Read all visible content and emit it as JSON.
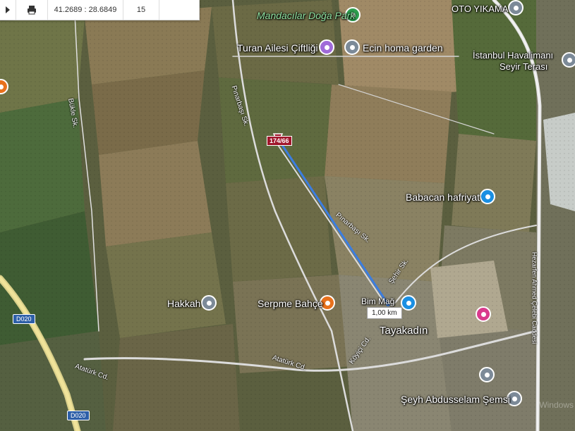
{
  "toolbar": {
    "coords": "41.2689 : 28.6849",
    "zoom": "15"
  },
  "places": {
    "mandacilar": "Mandacılar Doğa Park",
    "oto_yikama": "OTO YIKAMA",
    "turan": "Turan Ailesi Çiftliği",
    "ecin": "Ecin homa garden",
    "istanbul_airport": "İstanbul Havalimanı",
    "seyir": "Seyir Terası",
    "babacan": "Babacan hafriyat",
    "hakkah": "Hakkah",
    "serpme": "Serpme Bahçe",
    "bim": "Bim Mağ",
    "tayakadin": "Tayakadın",
    "seyh": "Şeyh Abdusselam Şemsi"
  },
  "roads": {
    "pinarbasi_upper": "Pınarbaşı Sk.",
    "pinarbasi_lower": "Pınarbaşı Sk.",
    "bukle": "Bükle Sk.",
    "ataturk_left": "Atatürk Cd.",
    "ataturk_right": "Atatürk Cd.",
    "koyici": "Köyiçi Cd.",
    "sehir": "Şehir Sk.",
    "hezarfen": "Hezarfen Ahmed Çelebi Caddesi"
  },
  "shields": {
    "d020_a": "D020",
    "d020_b": "D020"
  },
  "parcel": {
    "label": "174/66"
  },
  "measurement": {
    "distance": "1,00 km"
  },
  "colors": {
    "route": "#3b7de0",
    "parcel": "#a0162b",
    "pin_gray": "#7c8a98",
    "pin_orange": "#e8711c",
    "pin_blue": "#1a8fe3",
    "pin_green": "#2e9e4f",
    "pin_purple": "#a06ad8",
    "pin_pink": "#d93a8c"
  },
  "watermark": "Windows"
}
